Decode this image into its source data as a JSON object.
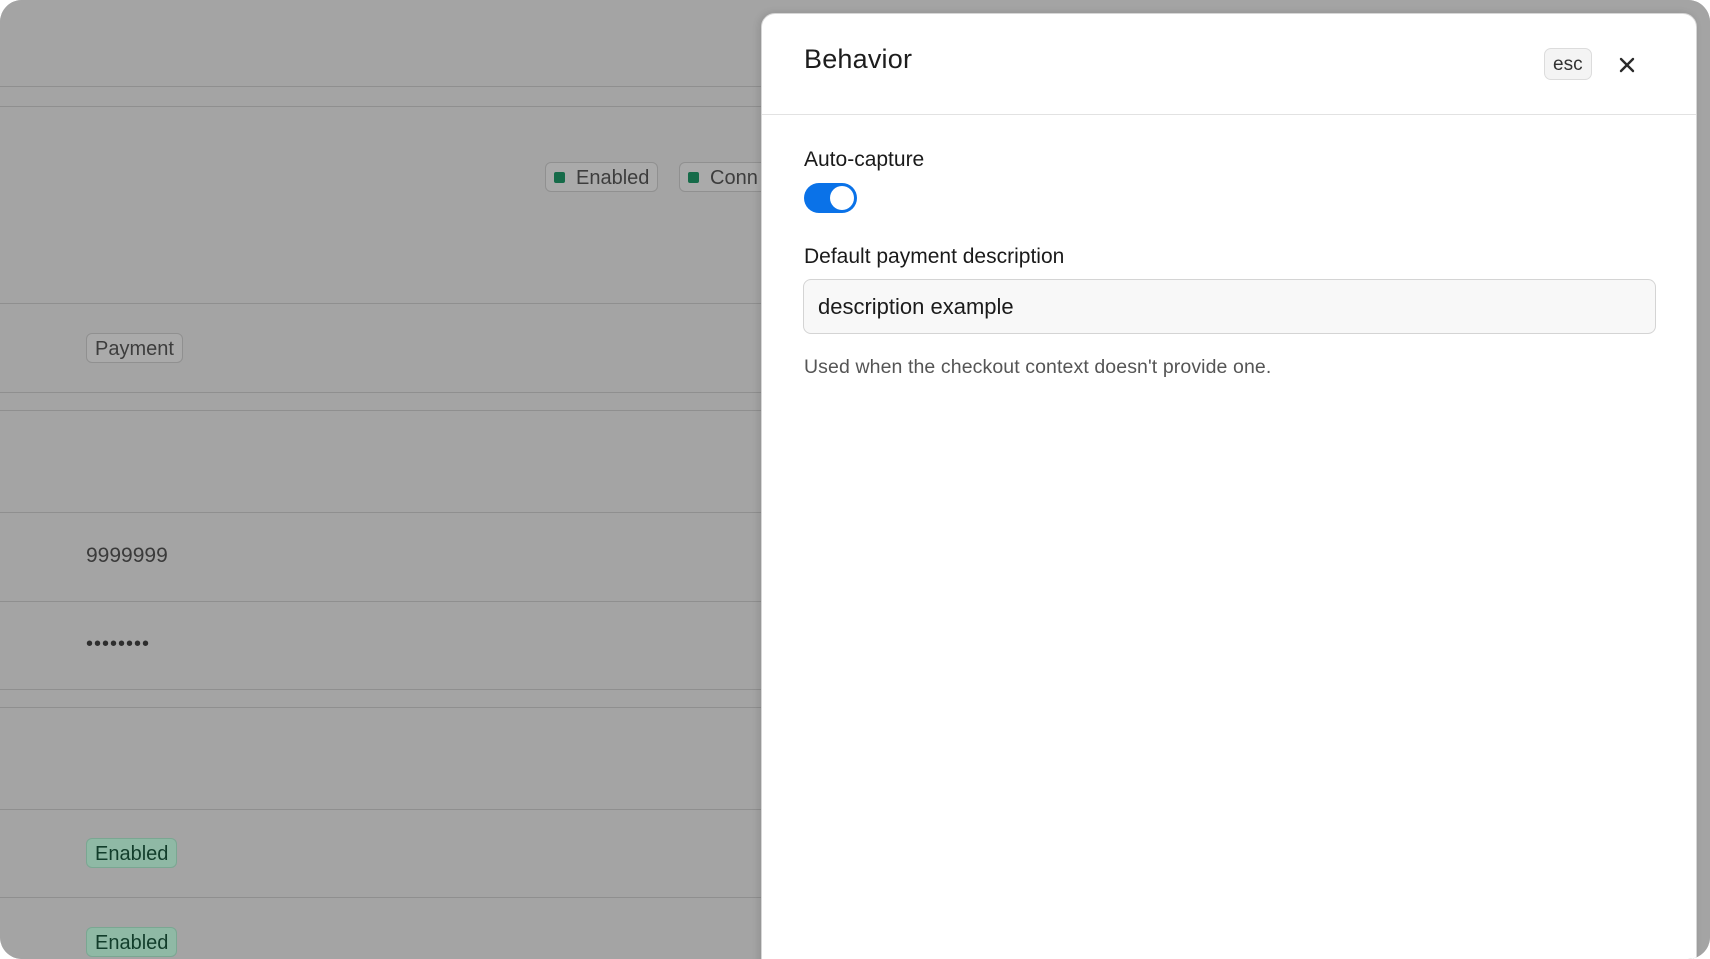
{
  "background_page": {
    "status_chips": [
      "Enabled",
      "Conn"
    ],
    "type_chip": "Payment",
    "merchant_value": "9999999",
    "secret_value": "••••••••",
    "enabled_badges": [
      "Enabled",
      "Enabled"
    ]
  },
  "drawer": {
    "title": "Behavior",
    "esc_label": "esc",
    "close_icon": "close-icon",
    "auto_capture": {
      "label": "Auto-capture",
      "enabled": true
    },
    "payment_description": {
      "label": "Default payment description",
      "value": "description example",
      "helper": "Used when the checkout context doesn't provide one."
    }
  },
  "colors": {
    "overlay": "#a4a4a4",
    "toggle_on": "#0a72e8",
    "status_dot": "#166b49"
  }
}
